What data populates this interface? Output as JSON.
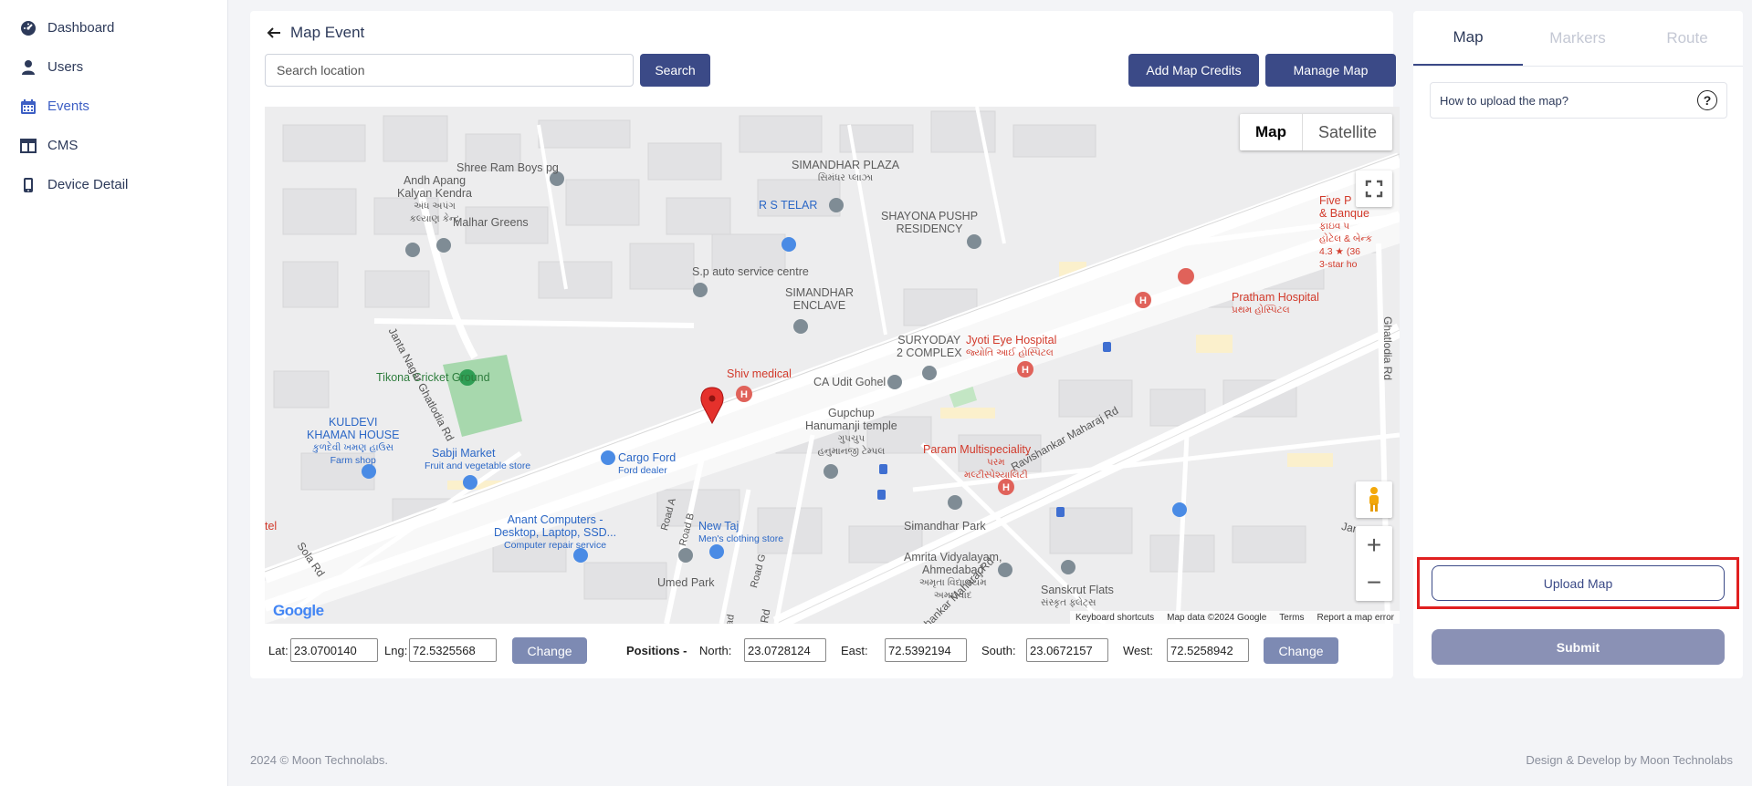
{
  "sidebar": {
    "items": [
      {
        "label": "Dashboard",
        "icon": "dashboard-icon"
      },
      {
        "label": "Users",
        "icon": "user-icon"
      },
      {
        "label": "Events",
        "icon": "calendar-icon"
      },
      {
        "label": "CMS",
        "icon": "cms-icon"
      },
      {
        "label": "Device Detail",
        "icon": "device-icon"
      }
    ],
    "active": "Events"
  },
  "header": {
    "title": "Map Event",
    "search_placeholder": "Search location",
    "search_label": "Search",
    "add_credits_label": "Add Map Credits",
    "manage_map_label": "Manage Map"
  },
  "map": {
    "type_map": "Map",
    "type_satellite": "Satellite",
    "zoom_in": "+",
    "zoom_out": "−",
    "google": "Google",
    "attribution": {
      "shortcuts": "Keyboard shortcuts",
      "data": "Map data ©2024 Google",
      "terms": "Terms",
      "report": "Report a map error"
    },
    "places": {
      "shree_ram": "Shree Ram Boys pg",
      "andh_apang_1": "Andh Apang",
      "andh_apang_2": "Kalyan Kendra",
      "andh_apang_gu1": "અંધ અપંગ",
      "andh_apang_gu2": "કલ્યાણ કેન્દ્ર",
      "malhar": "Malhar Greens",
      "simandhar_plaza": "SIMANDHAR PLAZA",
      "simandhar_plaza_gu": "સિમંધર પ્લાઝા",
      "rs_telar": "R S TELAR",
      "shayona_1": "SHAYONA PUSHP",
      "shayona_2": "RESIDENCY",
      "five_1": "Five P",
      "five_2": "& Banque",
      "five_gu1": "ફાઇવ પ",
      "five_gu2": "હોટેલ & બેન્ક",
      "five_rating": "4.3 ★ (36",
      "five_star": "3-star ho",
      "sp_auto": "S.p auto service centre",
      "simandhar_enclave_1": "SIMANDHAR",
      "simandhar_enclave_2": "ENCLAVE",
      "pratham_1": "Pratham Hospital",
      "pratham_gu": "પ્રથમ હોસ્પિટલ",
      "suryoday_1": "SURYODAY",
      "suryoday_2": "2 COMPLEX",
      "jyoti_1": "Jyoti Eye Hospital",
      "jyoti_gu": "જ્યોતિ આઈ હોસ્પિટલ",
      "tikona": "Tikona Cricket Ground",
      "shiv": "Shiv medical",
      "ca_udit": "CA Udit Gohel",
      "gupchup_1": "Gupchup",
      "gupchup_2": "Hanumanji temple",
      "gupchup_gu1": "ગુપચુપ",
      "gupchup_gu2": "હનુમાનજી ટેમ્પલ",
      "kuldevi_1": "KULDEVI",
      "kuldevi_2": "KHAMAN HOUSE",
      "kuldevi_gu": "કુળદેવી ખમણ હાઉસ",
      "kuldevi_3": "Farm shop",
      "sabji_1": "Sabji Market",
      "sabji_2": "Fruit and vegetable store",
      "cargo_1": "Cargo Ford",
      "cargo_2": "Ford dealer",
      "param_1": "Param Multispeciality",
      "param_gu1": "પરમ",
      "param_gu2": "મલ્ટીસ્પેશ્યાલિટી",
      "anant_1": "Anant Computers -",
      "anant_2": "Desktop, Laptop, SSD...",
      "anant_3": "Computer repair service",
      "new_taj_1": "New Taj",
      "new_taj_2": "Men's clothing store",
      "umed": "Umed Park",
      "simandhar_park": "Simandhar Park",
      "amrita_1": "Amrita Vidyalayam,",
      "amrita_2": "Ahmedabad",
      "amrita_gu1": "અમૃતા વિદ્યાલયમ",
      "amrita_gu2": "અમદાવાદ",
      "sanskrut_1": "Sanskrut Flats",
      "sanskrut_gu": "સંસ્કૃત ફ્લેટ્સ",
      "tel": "tel"
    },
    "roads": {
      "janta_nagar": "Janta Nagar Ghatlodia Rd",
      "ravishankar_1": "Ravishankar Maharaj Rd",
      "ravishankar_2": "Ravishankar Maharaj Rd",
      "ghatlodia": "Ghatlodia Rd",
      "sola": "Sola Rd",
      "road_a": "Road A",
      "road_b": "Road B",
      "road_g": "Road G",
      "janta_na": "Janta Na",
      "rd": "Rd",
      "ad": "ad"
    }
  },
  "coords": {
    "lat_label": "Lat:",
    "lat": "23.0700140",
    "lng_label": "Lng:",
    "lng": "72.5325568",
    "change_label": "Change",
    "positions_label": "Positions -",
    "north_label": "North:",
    "north": "23.0728124",
    "east_label": "East:",
    "east": "72.5392194",
    "south_label": "South:",
    "south": "23.0672157",
    "west_label": "West:",
    "west": "72.5258942",
    "change2_label": "Change"
  },
  "panel": {
    "tabs": [
      "Map",
      "Markers",
      "Route"
    ],
    "active_tab": "Map",
    "howto": "How to upload the map?",
    "help_icon": "?",
    "upload_label": "Upload Map",
    "submit_label": "Submit"
  },
  "footer": {
    "left": "2024 © Moon Technolabs.",
    "right": "Design & Develop by Moon Technolabs"
  },
  "colors": {
    "primary": "#3b4a87",
    "active_nav": "#3d5fc4",
    "highlight": "#e02020"
  }
}
